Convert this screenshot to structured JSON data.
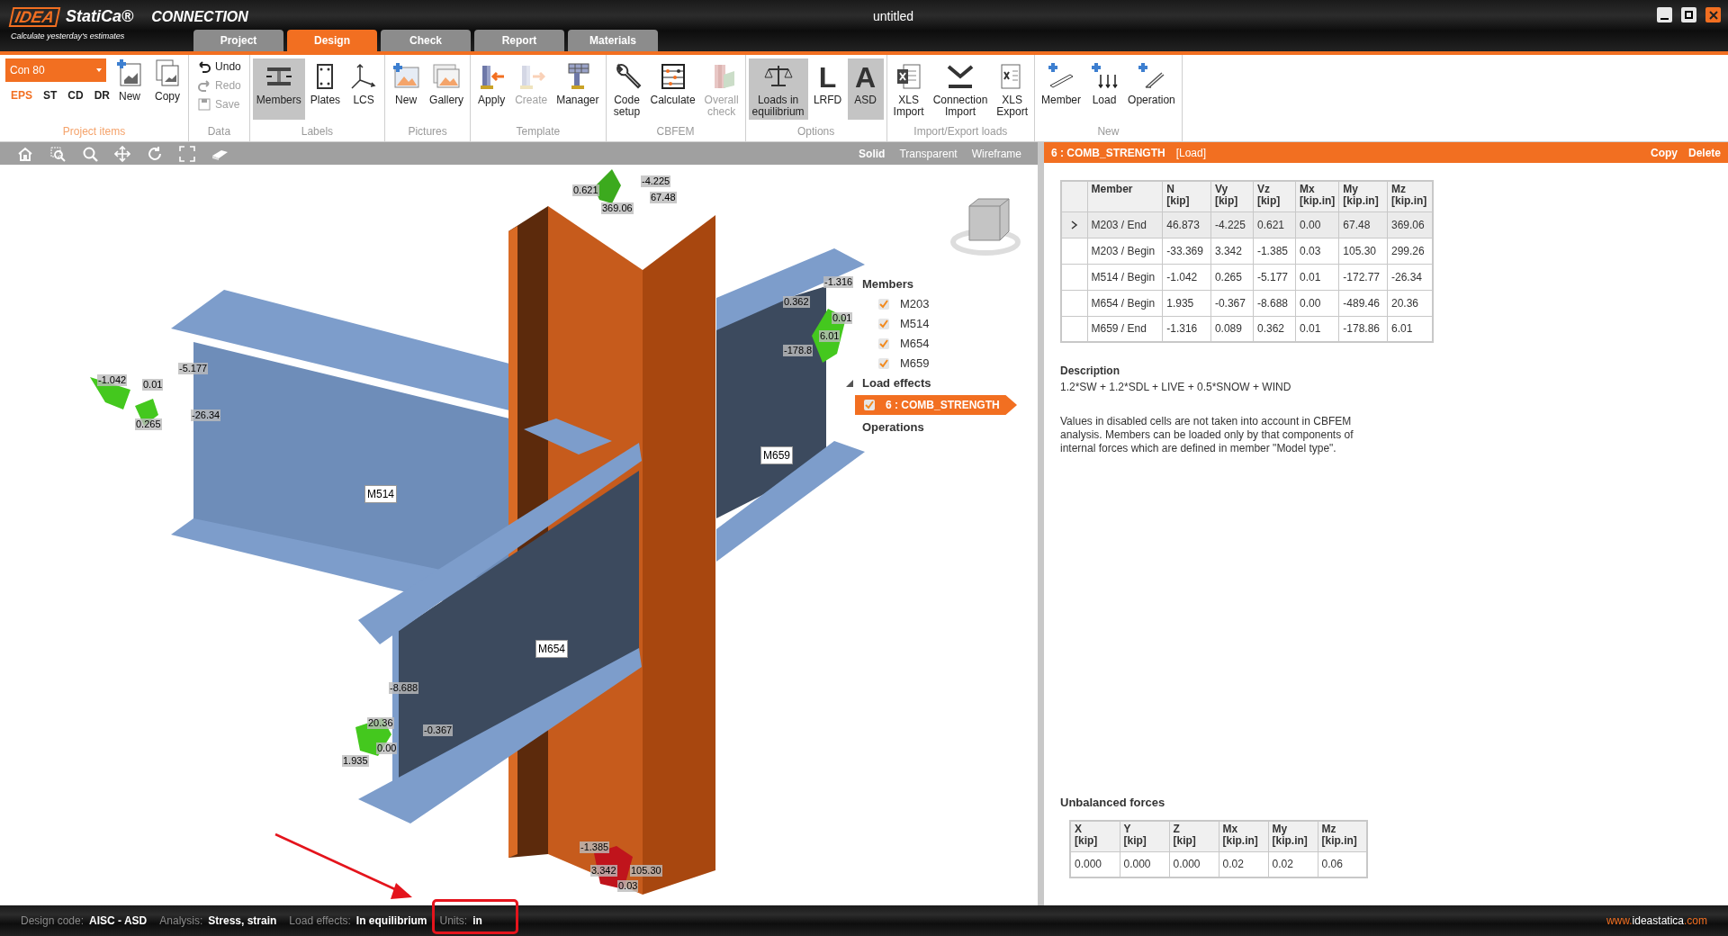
{
  "app": {
    "logo": "IDEA",
    "brand": "StatiCa®",
    "product": "CONNECTION",
    "tagline": "Calculate yesterday's estimates"
  },
  "window": {
    "title": "untitled"
  },
  "tabs": [
    {
      "label": "Project",
      "selected": false
    },
    {
      "label": "Design",
      "selected": true
    },
    {
      "label": "Check",
      "selected": false
    },
    {
      "label": "Report",
      "selected": false
    },
    {
      "label": "Materials",
      "selected": false
    }
  ],
  "project_items": {
    "label": "Project items",
    "dropdown": "Con 80",
    "codes": [
      {
        "label": "EPS",
        "selected": true
      },
      {
        "label": "ST",
        "selected": false
      },
      {
        "label": "CD",
        "selected": false
      },
      {
        "label": "DR",
        "selected": false
      }
    ],
    "buttons": [
      {
        "kind": "new-item",
        "lines": [
          "New"
        ],
        "disabled": false,
        "active": false
      },
      {
        "kind": "copy",
        "lines": [
          "Copy"
        ],
        "disabled": false,
        "active": false
      }
    ]
  },
  "data_group": {
    "label": "Data",
    "items": [
      {
        "kind": "undo",
        "label": "Undo",
        "disabled": false
      },
      {
        "kind": "redo",
        "label": "Redo",
        "disabled": true
      },
      {
        "kind": "save",
        "label": "Save",
        "disabled": true
      }
    ]
  },
  "groups": [
    {
      "label": "Labels",
      "buttons": [
        {
          "kind": "members",
          "lines": [
            "Members"
          ],
          "disabled": false,
          "active": true
        },
        {
          "kind": "plates",
          "lines": [
            "Plates"
          ],
          "disabled": false,
          "active": false
        },
        {
          "kind": "lcs",
          "lines": [
            "LCS"
          ],
          "disabled": false,
          "active": false
        }
      ]
    },
    {
      "label": "Pictures",
      "buttons": [
        {
          "kind": "picture-new",
          "lines": [
            "New"
          ],
          "disabled": false,
          "active": false
        },
        {
          "kind": "gallery",
          "lines": [
            "Gallery"
          ],
          "disabled": false,
          "active": false
        }
      ]
    },
    {
      "label": "Template",
      "buttons": [
        {
          "kind": "apply",
          "lines": [
            "Apply"
          ],
          "disabled": false,
          "active": false
        },
        {
          "kind": "create",
          "lines": [
            "Create"
          ],
          "disabled": true,
          "active": false
        },
        {
          "kind": "manager",
          "lines": [
            "Manager"
          ],
          "disabled": false,
          "active": false
        }
      ]
    },
    {
      "label": "CBFEM",
      "buttons": [
        {
          "kind": "code-setup",
          "lines": [
            "Code",
            "setup"
          ],
          "disabled": false,
          "active": false
        },
        {
          "kind": "calculate",
          "lines": [
            "Calculate"
          ],
          "disabled": false,
          "active": false
        },
        {
          "kind": "overall-check",
          "lines": [
            "Overall",
            "check"
          ],
          "disabled": true,
          "active": false
        }
      ]
    },
    {
      "label": "Options",
      "buttons": [
        {
          "kind": "balance",
          "lines": [
            "Loads in",
            "equilibrium"
          ],
          "disabled": false,
          "active": true
        },
        {
          "kind": "letter",
          "glyph": "L",
          "lines": [
            "LRFD"
          ],
          "disabled": false,
          "active": false
        },
        {
          "kind": "letter",
          "glyph": "A",
          "lines": [
            "ASD"
          ],
          "disabled": false,
          "active": true
        }
      ]
    },
    {
      "label": "Import/Export loads",
      "buttons": [
        {
          "kind": "xls-import",
          "lines": [
            "XLS",
            "Import"
          ],
          "disabled": false,
          "active": false
        },
        {
          "kind": "connection-import",
          "lines": [
            "Connection",
            "Import"
          ],
          "disabled": false,
          "active": false
        },
        {
          "kind": "xls-export",
          "lines": [
            "XLS",
            "Export"
          ],
          "disabled": false,
          "active": false
        }
      ]
    },
    {
      "label": "New",
      "buttons": [
        {
          "kind": "member-add",
          "lines": [
            "Member"
          ],
          "disabled": false,
          "active": false
        },
        {
          "kind": "load-add",
          "lines": [
            "Load"
          ],
          "disabled": false,
          "active": false
        },
        {
          "kind": "operation-add",
          "lines": [
            "Operation"
          ],
          "disabled": false,
          "active": false
        }
      ]
    }
  ],
  "view_modes": [
    {
      "label": "Solid",
      "selected": true
    },
    {
      "label": "Transparent",
      "selected": false
    },
    {
      "label": "Wireframe",
      "selected": false
    }
  ],
  "model_labels": [
    "M514",
    "M659",
    "M654"
  ],
  "force_labels": [
    "0.621",
    "369.06",
    "-4.225",
    "67.48",
    "-1.042",
    "0.01",
    "-5.177",
    "0.265",
    "-26.34",
    "0.362",
    "-1.316",
    "0.01",
    "6.01",
    "-178.8",
    "-8.688",
    "20.36",
    "-0.367",
    "0.00",
    "1.935",
    "-1.385",
    "3.342",
    "105.30",
    "0.03"
  ],
  "tree": {
    "members": {
      "label": "Members",
      "items": [
        {
          "label": "M203",
          "checked": true
        },
        {
          "label": "M514",
          "checked": true
        },
        {
          "label": "M654",
          "checked": true
        },
        {
          "label": "M659",
          "checked": true
        }
      ]
    },
    "load_effects": {
      "label": "Load effects",
      "expanded": true,
      "items": [
        {
          "label": "6 : COMB_STRENGTH",
          "checked": true,
          "selected": true
        }
      ]
    },
    "operations": {
      "label": "Operations"
    }
  },
  "panel": {
    "title": "6 : COMB_STRENGTH",
    "tag": "[Load]",
    "actions": [
      "Copy",
      "Delete"
    ],
    "loads_table": {
      "columns": [
        {
          "name": "Member"
        },
        {
          "name": "N",
          "unit": "[kip]"
        },
        {
          "name": "Vy",
          "unit": "[kip]"
        },
        {
          "name": "Vz",
          "unit": "[kip]"
        },
        {
          "name": "Mx",
          "unit": "[kip.in]"
        },
        {
          "name": "My",
          "unit": "[kip.in]"
        },
        {
          "name": "Mz",
          "unit": "[kip.in]"
        }
      ],
      "rows": [
        {
          "selected": true,
          "cells": [
            "M203 / End",
            "46.873",
            "-4.225",
            "0.621",
            "0.00",
            "67.48",
            "369.06"
          ]
        },
        {
          "selected": false,
          "cells": [
            "M203 / Begin",
            "-33.369",
            "3.342",
            "-1.385",
            "0.03",
            "105.30",
            "299.26"
          ]
        },
        {
          "selected": false,
          "cells": [
            "M514 / Begin",
            "-1.042",
            "0.265",
            "-5.177",
            "0.01",
            "-172.77",
            "-26.34"
          ]
        },
        {
          "selected": false,
          "cells": [
            "M654 / Begin",
            "1.935",
            "-0.367",
            "-8.688",
            "0.00",
            "-489.46",
            "20.36"
          ]
        },
        {
          "selected": false,
          "cells": [
            "M659 / End",
            "-1.316",
            "0.089",
            "0.362",
            "0.01",
            "-178.86",
            "6.01"
          ]
        }
      ]
    },
    "description": {
      "title": "Description",
      "text": "1.2*SW + 1.2*SDL + LIVE + 0.5*SNOW + WIND"
    },
    "note": "Values in disabled cells are not taken into account in CBFEM analysis. Members can be loaded only by that components of internal forces which are defined in member \"Model type\".",
    "unbalanced": {
      "title": "Unbalanced forces",
      "columns": [
        {
          "name": "X",
          "unit": "[kip]"
        },
        {
          "name": "Y",
          "unit": "[kip]"
        },
        {
          "name": "Z",
          "unit": "[kip]"
        },
        {
          "name": "Mx",
          "unit": "[kip.in]"
        },
        {
          "name": "My",
          "unit": "[kip.in]"
        },
        {
          "name": "Mz",
          "unit": "[kip.in]"
        }
      ],
      "rows": [
        [
          "0.000",
          "0.000",
          "0.000",
          "0.02",
          "0.02",
          "0.06"
        ]
      ]
    }
  },
  "status_bar": {
    "items": [
      {
        "label": "Design code:",
        "value": "AISC - ASD"
      },
      {
        "label": "Analysis:",
        "value": "Stress, strain"
      },
      {
        "label": "Load effects:",
        "value": "In equilibrium"
      },
      {
        "label": "Units:",
        "value": "in"
      }
    ],
    "website": {
      "prefix": "www.",
      "name": "ideastatica",
      "suffix": ".com"
    }
  }
}
